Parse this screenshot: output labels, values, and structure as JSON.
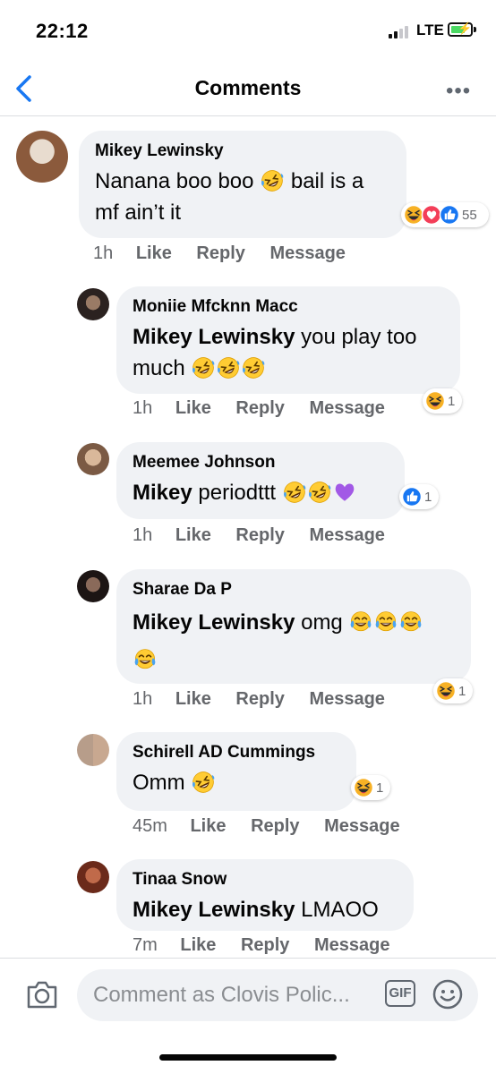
{
  "status_bar": {
    "time": "22:12",
    "network": "LTE"
  },
  "header": {
    "title": "Comments"
  },
  "actions": {
    "like": "Like",
    "reply": "Reply",
    "message": "Message"
  },
  "comments": [
    {
      "author": "Mikey Lewinsky",
      "mention": "",
      "text": "Nanana boo boo",
      "text_after": "bail is a mf ain’t it",
      "emojis": [
        "rofl"
      ],
      "time": "1h",
      "reaction_count": "55",
      "reactions": [
        "haha",
        "love",
        "like"
      ]
    },
    {
      "author": "Moniie Mfcknn Macc",
      "mention": "Mikey Lewinsky",
      "text": "you play too much",
      "emojis": [
        "rofl",
        "rofl",
        "rofl"
      ],
      "time": "1h",
      "reaction_count": "1",
      "reactions": [
        "haha"
      ]
    },
    {
      "author": "Meemee Johnson",
      "mention": "Mikey",
      "text": "periodttt",
      "emojis": [
        "rofl",
        "rofl",
        "purple-heart"
      ],
      "time": "1h",
      "reaction_count": "1",
      "reactions": [
        "like"
      ]
    },
    {
      "author": "Sharae Da P",
      "mention": "Mikey Lewinsky",
      "text": "omg",
      "emojis": [
        "tears-of-joy",
        "tears-of-joy",
        "tears-of-joy",
        "tears-of-joy"
      ],
      "time": "1h",
      "reaction_count": "1",
      "reactions": [
        "haha"
      ]
    },
    {
      "author": "Schirell AD Cummings",
      "mention": "",
      "text": "Omm",
      "emojis": [
        "rofl"
      ],
      "time": "45m",
      "reaction_count": "1",
      "reactions": [
        "haha"
      ]
    },
    {
      "author": "Tinaa Snow",
      "mention": "Mikey Lewinsky",
      "text": "LMAOO",
      "emojis": [],
      "time": "7m",
      "reaction_count": "",
      "reactions": []
    }
  ],
  "composer": {
    "placeholder": "Comment as Clovis Polic...",
    "gif_label": "GIF"
  },
  "colors": {
    "accent": "#1877f2",
    "bubble": "#f0f2f5",
    "meta": "#65676b",
    "love": "#f33e58",
    "haha": "#f7b125",
    "heart_purple": "#a259e6"
  }
}
